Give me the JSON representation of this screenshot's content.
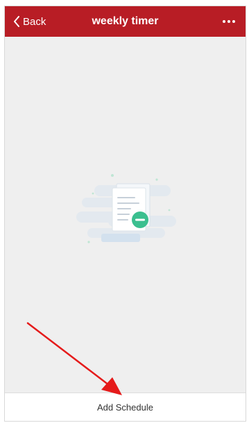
{
  "header": {
    "back_label": "Back",
    "title": "weekly timer",
    "back_icon": "chevron-left-icon",
    "more_icon": "more-dots-icon"
  },
  "empty_state": {
    "icon": "empty-document-illustration"
  },
  "footer": {
    "add_label": "Add Schedule"
  },
  "annotation": {
    "icon": "red-arrow-pointer"
  },
  "colors": {
    "nav_background": "#b81d25",
    "page_background": "#efefef",
    "accent_green": "#3bbf8f",
    "arrow_red": "#e51b1b"
  }
}
